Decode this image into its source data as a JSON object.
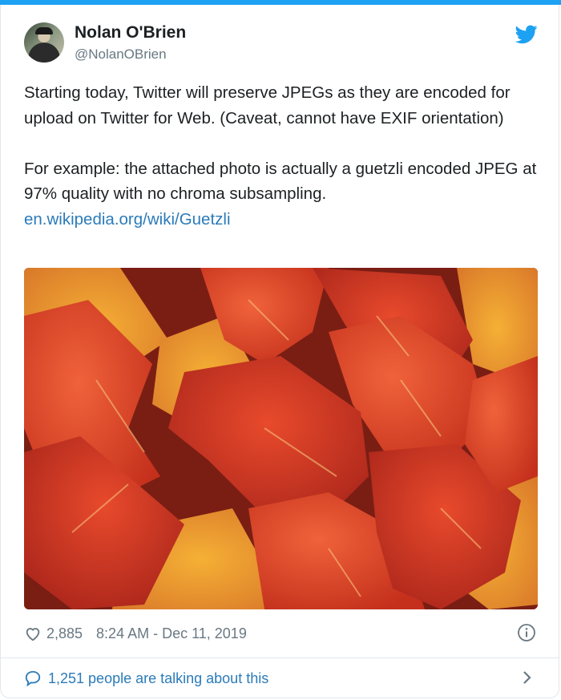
{
  "tweet": {
    "author": {
      "name": "Nolan O'Brien",
      "handle": "@NolanOBrien"
    },
    "paragraph1": "Starting today, Twitter will preserve JPEGs as they are encoded for upload on Twitter for Web. (Caveat, cannot have EXIF orientation)",
    "paragraph2": "For example: the attached photo is actually a guetzli encoded JPEG at 97% quality with no chroma subsampling.",
    "link": "en.wikipedia.org/wiki/Guetzli",
    "likes": "2,885",
    "timestamp": "8:24 AM - Dec 11, 2019",
    "talking": "1,251 people are talking about this"
  },
  "icons": {
    "brand": "twitter-bird-icon",
    "like": "heart-icon",
    "info": "info-icon",
    "reply": "speech-bubble-icon",
    "more": "chevron-right-icon"
  },
  "colors": {
    "accent": "#1da1f2",
    "link": "#2b7bb9",
    "muted": "#697882",
    "text": "#1c2022"
  }
}
